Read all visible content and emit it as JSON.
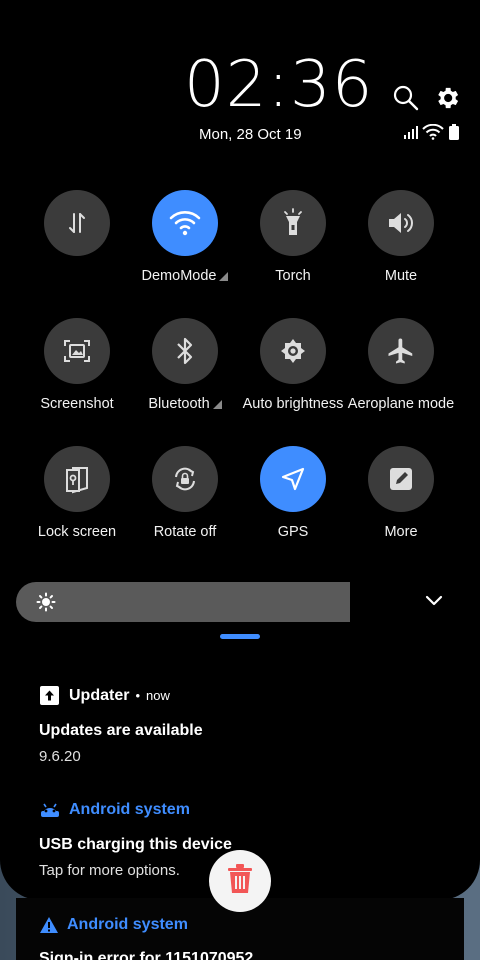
{
  "header": {
    "time": "02:36",
    "date": "Mon, 28 Oct 19"
  },
  "tiles": [
    {
      "label": "",
      "icon": "data-transfer-icon",
      "active": false
    },
    {
      "label": "DemoMode",
      "icon": "wifi-icon",
      "active": true,
      "has_menu": true
    },
    {
      "label": "Torch",
      "icon": "torch-icon",
      "active": false
    },
    {
      "label": "Mute",
      "icon": "volume-icon",
      "active": false
    },
    {
      "label": "Screenshot",
      "icon": "screenshot-icon",
      "active": false
    },
    {
      "label": "Bluetooth",
      "icon": "bluetooth-icon",
      "active": false,
      "has_menu": true
    },
    {
      "label": "Auto brightness",
      "icon": "auto-brightness-icon",
      "active": false
    },
    {
      "label": "Aeroplane mode",
      "icon": "airplane-icon",
      "active": false
    },
    {
      "label": "Lock screen",
      "icon": "lock-screen-icon",
      "active": false
    },
    {
      "label": "Rotate off",
      "icon": "rotate-lock-icon",
      "active": false
    },
    {
      "label": "GPS",
      "icon": "gps-icon",
      "active": true
    },
    {
      "label": "More",
      "icon": "edit-icon",
      "active": false
    }
  ],
  "brightness": {
    "level": 0.72
  },
  "notifications": [
    {
      "app": "Updater",
      "time": "now",
      "title": "Updates are available",
      "text": "9.6.20"
    },
    {
      "app": "Android system",
      "title": "USB charging this device",
      "text": "Tap for more options."
    },
    {
      "app": "Android system",
      "title": "Sign-in error for 1151070952",
      "text": ""
    }
  ],
  "colors": {
    "accent": "#3f8dff",
    "tile_off": "#3b3b3b",
    "delete": "#f25656"
  }
}
